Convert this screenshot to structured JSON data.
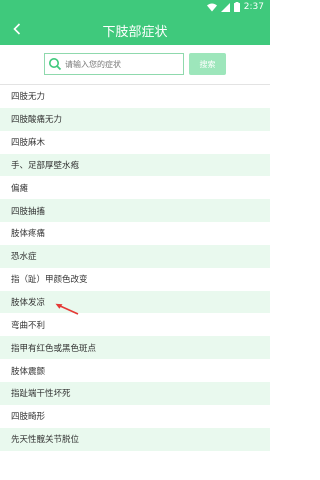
{
  "status_bar": {
    "time": "2:37"
  },
  "app_bar": {
    "title": "下肢部症状"
  },
  "search": {
    "placeholder": "请输入您的症状",
    "button_label": "搜索"
  },
  "symptoms": [
    "四肢无力",
    "四肢酸痛无力",
    "四肢麻木",
    "手、足部厚壁水疱",
    "偏瘫",
    "四肢抽搐",
    "肢体疼痛",
    "恐水症",
    "指（趾）甲颜色改变",
    "肢体发凉",
    "弯曲不利",
    "指甲有红色或黑色斑点",
    "肢体震颤",
    "指趾端干性坏死",
    "四肢畸形",
    "先天性髋关节脱位"
  ],
  "annotation": {
    "color": "#e53935"
  }
}
